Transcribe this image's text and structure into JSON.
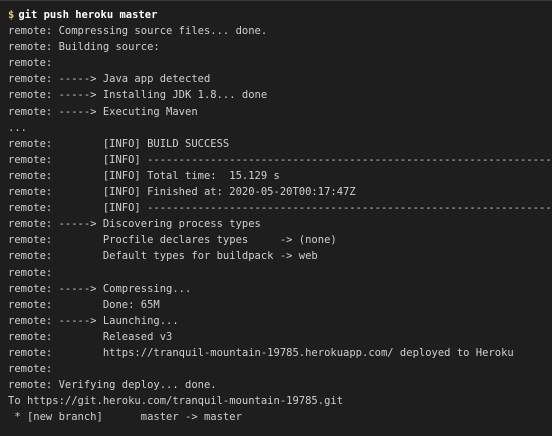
{
  "terminal": {
    "prompt_symbol": "$",
    "command": "git push heroku master",
    "lines": [
      "remote: Compressing source files... done.",
      "remote: Building source:",
      "remote:",
      "remote: -----> Java app detected",
      "remote: -----> Installing JDK 1.8... done",
      "remote: -----> Executing Maven",
      "...",
      "remote:        [INFO] BUILD SUCCESS",
      "remote:        [INFO] ------------------------------------------------------------------------",
      "remote:        [INFO] Total time:  15.129 s",
      "remote:        [INFO] Finished at: 2020-05-20T00:17:47Z",
      "remote:        [INFO] ------------------------------------------------------------------------",
      "remote: -----> Discovering process types",
      "remote:        Procfile declares types     -> (none)",
      "remote:        Default types for buildpack -> web",
      "remote:",
      "remote: -----> Compressing...",
      "remote:        Done: 65M",
      "remote: -----> Launching...",
      "remote:        Released v3",
      "remote:        https://tranquil-mountain-19785.herokuapp.com/ deployed to Heroku",
      "remote:",
      "remote: Verifying deploy... done.",
      "To https://git.heroku.com/tranquil-mountain-19785.git",
      " * [new branch]      master -> master"
    ]
  },
  "colors": {
    "background": "#1e1e1e",
    "text": "#cfcfcf",
    "prompt": "#e6c07b"
  }
}
